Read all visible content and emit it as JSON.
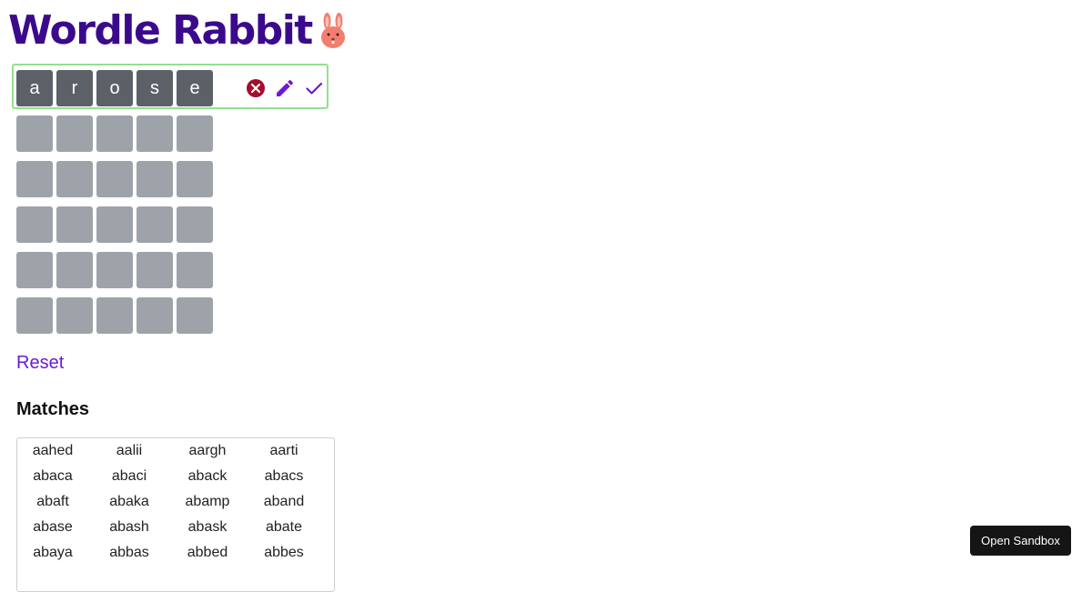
{
  "header": {
    "title": "Wordle Rabbit",
    "logo_icon": "rabbit-face-icon"
  },
  "board": {
    "active_row_letters": [
      "a",
      "r",
      "o",
      "s",
      "e"
    ],
    "empty_rows": 5,
    "actions": [
      {
        "name": "clear",
        "icon": "clear-circle-icon",
        "color": "#a50e2d"
      },
      {
        "name": "edit",
        "icon": "pencil-icon",
        "color": "#6a1bd6"
      },
      {
        "name": "confirm",
        "icon": "check-icon",
        "color": "#6a1bd6"
      }
    ]
  },
  "reset_label": "Reset",
  "matches": {
    "heading": "Matches",
    "words": [
      "aahed",
      "aalii",
      "aargh",
      "aarti",
      "abaca",
      "abaci",
      "aback",
      "abacs",
      "abaft",
      "abaka",
      "abamp",
      "aband",
      "abase",
      "abash",
      "abask",
      "abate",
      "abaya",
      "abbas",
      "abbed",
      "abbes"
    ]
  },
  "sandbox_button": "Open Sandbox",
  "colors": {
    "title": "#3b0a8c",
    "filled_tile": "#5c6168",
    "empty_tile": "#9ea3aa",
    "active_row_border": "#93e08f",
    "accent": "#6a1bd6",
    "rabbit": "#f47d6f"
  }
}
